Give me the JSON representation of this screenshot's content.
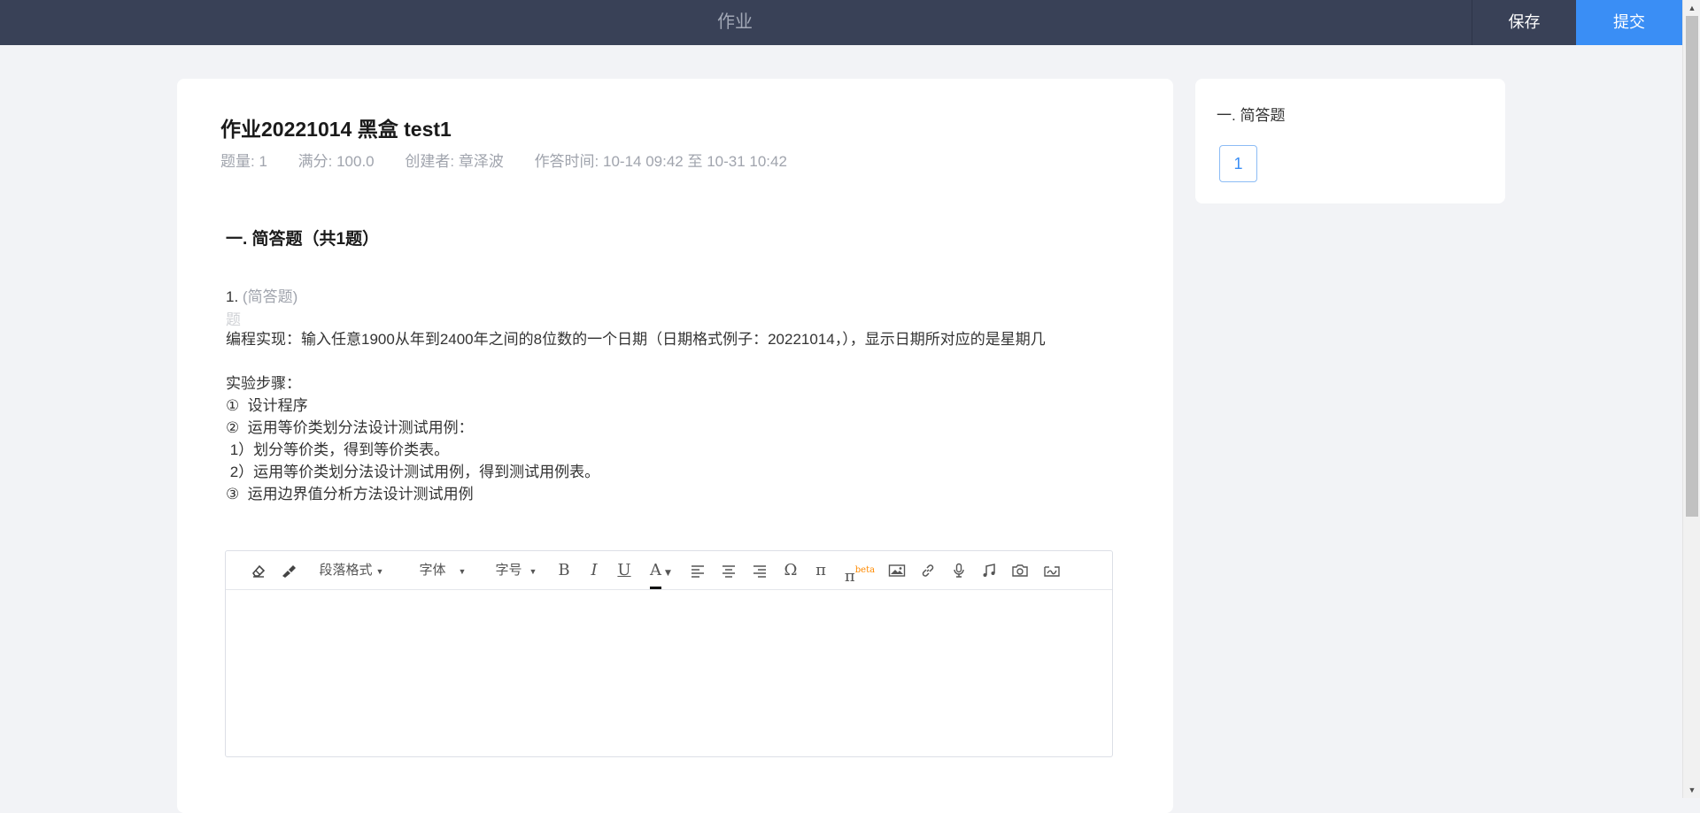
{
  "topbar": {
    "title": "作业",
    "save_label": "保存",
    "submit_label": "提交"
  },
  "homework": {
    "title": "作业20221014 黑盒 test1",
    "question_count": "题量: 1",
    "full_score": "满分: 100.0",
    "creator": "创建者: 章泽波",
    "answer_time": "作答时间:  10-14 09:42  至  10-31 10:42"
  },
  "section": {
    "title": "一. 简答题（共1题）"
  },
  "question": {
    "number": "1. ",
    "type": "(简答题)",
    "small_label": "题",
    "body": "编程实现：输入任意1900从年到2400年之间的8位数的一个日期（日期格式例子：20221014，），显示日期所对应的是星期几\n\n实验步骤：\n①  设计程序\n②  运用等价类划分法设计测试用例：\n 1）划分等价类，得到等价类表。\n 2）运用等价类划分法设计测试用例，得到测试用例表。\n③  运用边界值分析方法设计测试用例"
  },
  "editor": {
    "paragraph_format": "段落格式",
    "font_family": "字体",
    "font_size": "字号",
    "bold": "B",
    "italic": "I",
    "underline": "U",
    "font_color": "A",
    "omega": "Ω",
    "pi": "π",
    "pi_beta": "π",
    "beta_tag": "beta",
    "icons": [
      "eraser-icon",
      "format-brush-icon",
      "align-left-icon",
      "align-center-icon",
      "align-right-icon",
      "image-icon",
      "link-icon",
      "microphone-icon",
      "music-icon",
      "camera-icon",
      "sign-icon"
    ]
  },
  "side": {
    "section_label": "一. 简答题",
    "question_buttons": [
      "1"
    ]
  },
  "colors": {
    "topbar_bg": "#394157",
    "submit_bg": "#3a8ef5",
    "page_bg": "#f2f3f6",
    "beta": "#ff8a00"
  }
}
